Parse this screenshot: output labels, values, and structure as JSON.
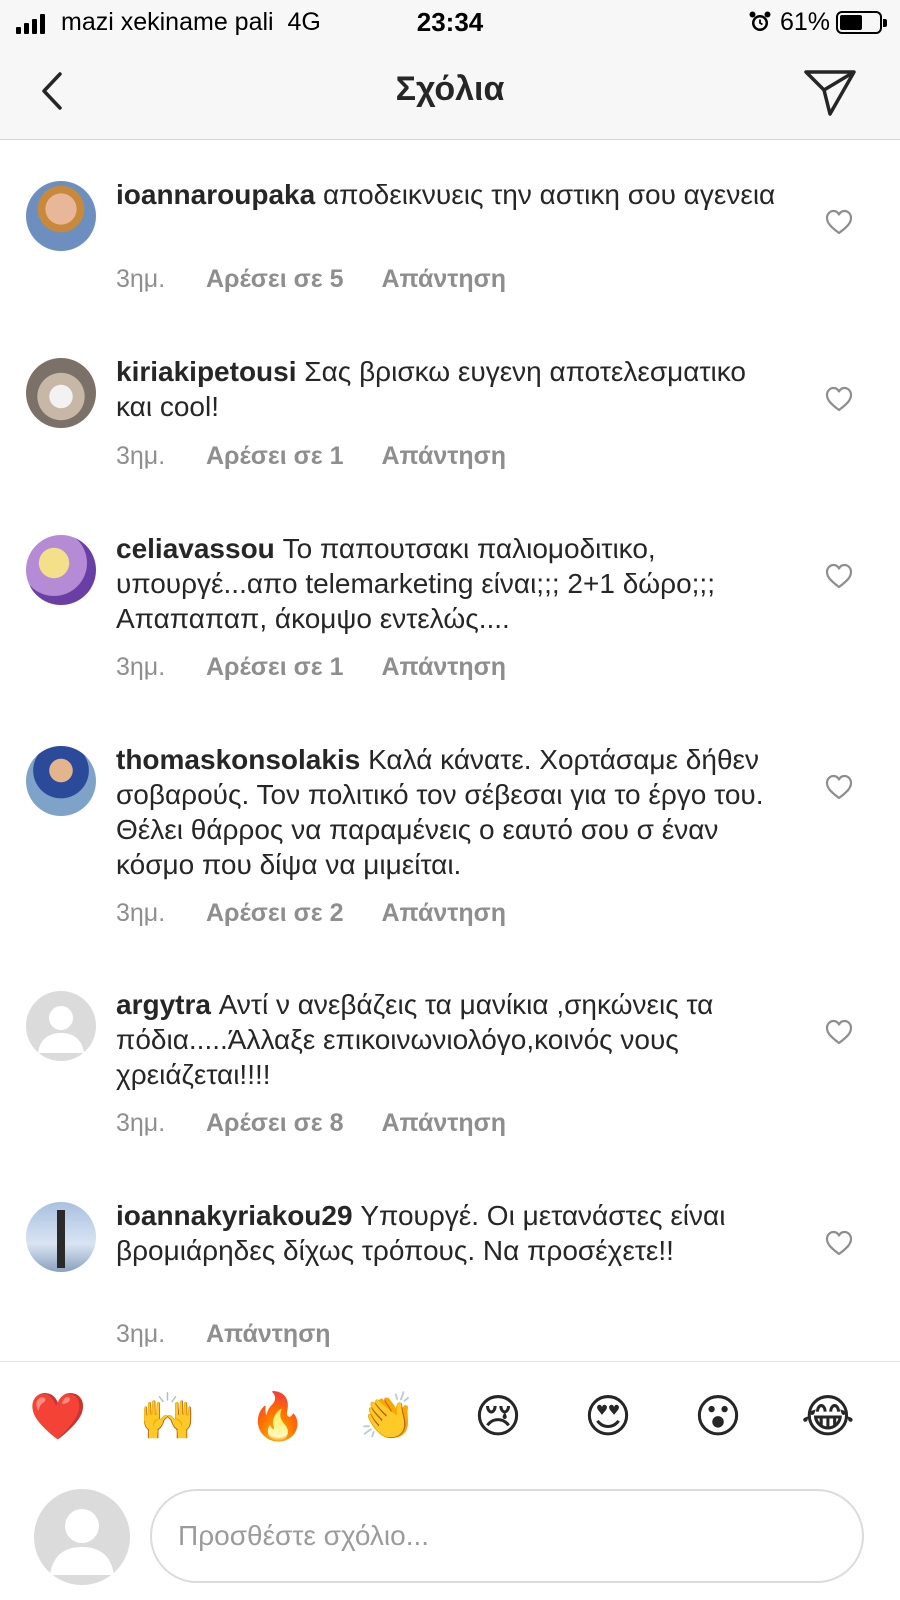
{
  "status_bar": {
    "carrier": "mazi xekiname pali",
    "network": "4G",
    "time": "23:34",
    "battery": "61%",
    "battery_level": 0.61
  },
  "header": {
    "title": "Σχόλια"
  },
  "comments": [
    {
      "username": "ioannaroupaka",
      "text": "αποδεικνυεις την αστικη σου αγενεια",
      "time": "3ημ.",
      "likes": "Αρέσει σε 5",
      "reply": "Απάντηση",
      "avatar": "photo"
    },
    {
      "username": "kiriakipetousi",
      "text": "Σας βρισκω ευγενη αποτελεσματικο και cool!",
      "time": "3ημ.",
      "likes": "Αρέσει σε 1",
      "reply": "Απάντηση",
      "avatar": "photo"
    },
    {
      "username": "celiavassou",
      "text": "Το παπουτσακι παλιομοδιτικο, υπουργέ...απο telemarketing είναι;;; 2+1 δώρο;;; Απαπαπαπ, άκομψο εντελώς....",
      "time": "3ημ.",
      "likes": "Αρέσει σε 1",
      "reply": "Απάντηση",
      "avatar": "photo"
    },
    {
      "username": "thomaskonsolakis",
      "text": "Καλά κάνατε. Χορτάσαμε δήθεν σοβαρούς. Τον πολιτικό τον σέβεσαι για το έργο του. Θέλει θάρρος να παραμένεις ο εαυτό σου σ έναν κόσμο που δίψα να μιμείται.",
      "time": "3ημ.",
      "likes": "Αρέσει σε 2",
      "reply": "Απάντηση",
      "avatar": "photo"
    },
    {
      "username": "argytra",
      "text": "Αντί ν ανεβάζεις τα μανίκια ,σηκώνεις τα πόδια.....Άλλαξε επικοινωνιολόγο,κοινός νους χρειάζεται!!!!",
      "time": "3ημ.",
      "likes": "Αρέσει σε 8",
      "reply": "Απάντηση",
      "avatar": "default"
    },
    {
      "username": "ioannakyriakou29",
      "text": "Υπουργέ. Οι μετανάστες είναι βρομιάρηδες δίχως τρόπους. Να προσέχετε!!",
      "time": "3ημ.",
      "likes": "",
      "reply": "Απάντηση",
      "avatar": "photo"
    }
  ],
  "emojis": [
    "❤️",
    "🙌",
    "🔥",
    "👏",
    "😢",
    "😍",
    "😮",
    "😂"
  ],
  "composer": {
    "placeholder": "Προσθέστε σχόλιο..."
  },
  "colors": {
    "text": "#262626",
    "meta": "#8e8e8e",
    "bar_bg": "#f7f7f7",
    "border": "#dbdbdb"
  }
}
